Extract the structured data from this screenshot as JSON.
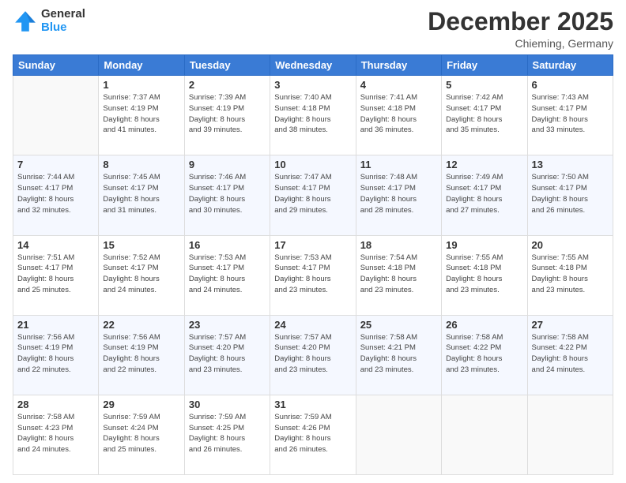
{
  "header": {
    "logo_general": "General",
    "logo_blue": "Blue",
    "month": "December 2025",
    "location": "Chieming, Germany"
  },
  "days_of_week": [
    "Sunday",
    "Monday",
    "Tuesday",
    "Wednesday",
    "Thursday",
    "Friday",
    "Saturday"
  ],
  "weeks": [
    [
      {
        "day": "",
        "info": ""
      },
      {
        "day": "1",
        "info": "Sunrise: 7:37 AM\nSunset: 4:19 PM\nDaylight: 8 hours\nand 41 minutes."
      },
      {
        "day": "2",
        "info": "Sunrise: 7:39 AM\nSunset: 4:19 PM\nDaylight: 8 hours\nand 39 minutes."
      },
      {
        "day": "3",
        "info": "Sunrise: 7:40 AM\nSunset: 4:18 PM\nDaylight: 8 hours\nand 38 minutes."
      },
      {
        "day": "4",
        "info": "Sunrise: 7:41 AM\nSunset: 4:18 PM\nDaylight: 8 hours\nand 36 minutes."
      },
      {
        "day": "5",
        "info": "Sunrise: 7:42 AM\nSunset: 4:17 PM\nDaylight: 8 hours\nand 35 minutes."
      },
      {
        "day": "6",
        "info": "Sunrise: 7:43 AM\nSunset: 4:17 PM\nDaylight: 8 hours\nand 33 minutes."
      }
    ],
    [
      {
        "day": "7",
        "info": "Sunrise: 7:44 AM\nSunset: 4:17 PM\nDaylight: 8 hours\nand 32 minutes."
      },
      {
        "day": "8",
        "info": "Sunrise: 7:45 AM\nSunset: 4:17 PM\nDaylight: 8 hours\nand 31 minutes."
      },
      {
        "day": "9",
        "info": "Sunrise: 7:46 AM\nSunset: 4:17 PM\nDaylight: 8 hours\nand 30 minutes."
      },
      {
        "day": "10",
        "info": "Sunrise: 7:47 AM\nSunset: 4:17 PM\nDaylight: 8 hours\nand 29 minutes."
      },
      {
        "day": "11",
        "info": "Sunrise: 7:48 AM\nSunset: 4:17 PM\nDaylight: 8 hours\nand 28 minutes."
      },
      {
        "day": "12",
        "info": "Sunrise: 7:49 AM\nSunset: 4:17 PM\nDaylight: 8 hours\nand 27 minutes."
      },
      {
        "day": "13",
        "info": "Sunrise: 7:50 AM\nSunset: 4:17 PM\nDaylight: 8 hours\nand 26 minutes."
      }
    ],
    [
      {
        "day": "14",
        "info": "Sunrise: 7:51 AM\nSunset: 4:17 PM\nDaylight: 8 hours\nand 25 minutes."
      },
      {
        "day": "15",
        "info": "Sunrise: 7:52 AM\nSunset: 4:17 PM\nDaylight: 8 hours\nand 24 minutes."
      },
      {
        "day": "16",
        "info": "Sunrise: 7:53 AM\nSunset: 4:17 PM\nDaylight: 8 hours\nand 24 minutes."
      },
      {
        "day": "17",
        "info": "Sunrise: 7:53 AM\nSunset: 4:17 PM\nDaylight: 8 hours\nand 23 minutes."
      },
      {
        "day": "18",
        "info": "Sunrise: 7:54 AM\nSunset: 4:18 PM\nDaylight: 8 hours\nand 23 minutes."
      },
      {
        "day": "19",
        "info": "Sunrise: 7:55 AM\nSunset: 4:18 PM\nDaylight: 8 hours\nand 23 minutes."
      },
      {
        "day": "20",
        "info": "Sunrise: 7:55 AM\nSunset: 4:18 PM\nDaylight: 8 hours\nand 23 minutes."
      }
    ],
    [
      {
        "day": "21",
        "info": "Sunrise: 7:56 AM\nSunset: 4:19 PM\nDaylight: 8 hours\nand 22 minutes."
      },
      {
        "day": "22",
        "info": "Sunrise: 7:56 AM\nSunset: 4:19 PM\nDaylight: 8 hours\nand 22 minutes."
      },
      {
        "day": "23",
        "info": "Sunrise: 7:57 AM\nSunset: 4:20 PM\nDaylight: 8 hours\nand 23 minutes."
      },
      {
        "day": "24",
        "info": "Sunrise: 7:57 AM\nSunset: 4:20 PM\nDaylight: 8 hours\nand 23 minutes."
      },
      {
        "day": "25",
        "info": "Sunrise: 7:58 AM\nSunset: 4:21 PM\nDaylight: 8 hours\nand 23 minutes."
      },
      {
        "day": "26",
        "info": "Sunrise: 7:58 AM\nSunset: 4:22 PM\nDaylight: 8 hours\nand 23 minutes."
      },
      {
        "day": "27",
        "info": "Sunrise: 7:58 AM\nSunset: 4:22 PM\nDaylight: 8 hours\nand 24 minutes."
      }
    ],
    [
      {
        "day": "28",
        "info": "Sunrise: 7:58 AM\nSunset: 4:23 PM\nDaylight: 8 hours\nand 24 minutes."
      },
      {
        "day": "29",
        "info": "Sunrise: 7:59 AM\nSunset: 4:24 PM\nDaylight: 8 hours\nand 25 minutes."
      },
      {
        "day": "30",
        "info": "Sunrise: 7:59 AM\nSunset: 4:25 PM\nDaylight: 8 hours\nand 26 minutes."
      },
      {
        "day": "31",
        "info": "Sunrise: 7:59 AM\nSunset: 4:26 PM\nDaylight: 8 hours\nand 26 minutes."
      },
      {
        "day": "",
        "info": ""
      },
      {
        "day": "",
        "info": ""
      },
      {
        "day": "",
        "info": ""
      }
    ]
  ]
}
